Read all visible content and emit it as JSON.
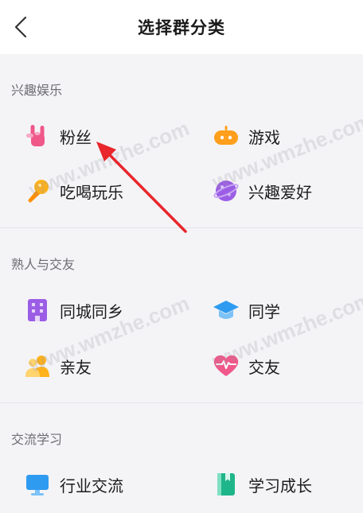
{
  "header": {
    "title": "选择群分类"
  },
  "sections": [
    {
      "title": "兴趣娱乐",
      "items": [
        {
          "label": "粉丝",
          "icon": "rock-hand-icon"
        },
        {
          "label": "游戏",
          "icon": "gamepad-icon"
        },
        {
          "label": "吃喝玩乐",
          "icon": "microphone-icon"
        },
        {
          "label": "兴趣爱好",
          "icon": "planet-icon"
        }
      ]
    },
    {
      "title": "熟人与交友",
      "items": [
        {
          "label": "同城同乡",
          "icon": "building-icon"
        },
        {
          "label": "同学",
          "icon": "graduation-cap-icon"
        },
        {
          "label": "亲友",
          "icon": "people-icon"
        },
        {
          "label": "交友",
          "icon": "heart-pulse-icon"
        }
      ]
    },
    {
      "title": "交流学习",
      "items": [
        {
          "label": "行业交流",
          "icon": "monitor-icon"
        },
        {
          "label": "学习成长",
          "icon": "book-icon"
        }
      ]
    }
  ],
  "watermark": "www.wmzhe.com",
  "colors": {
    "accent_pink": "#f0588a",
    "accent_orange": "#ff9f1c",
    "accent_purple": "#9b5de5",
    "accent_blue": "#2f9bf0",
    "accent_green": "#1fb58a",
    "arrow_red": "#e8262b"
  }
}
